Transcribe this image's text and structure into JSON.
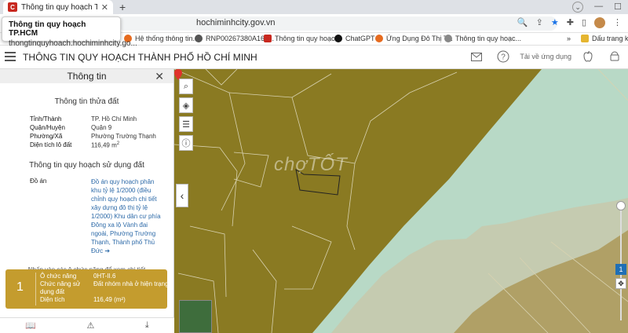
{
  "browser": {
    "tab_title": "Thông tin quy hoạch TP.HCM",
    "url_visible": "hochiminhcity.gov.vn",
    "tooltip": {
      "title": "Thông tin quy hoạch TP.HCM",
      "url": "thongtinquyhoach.hochiminhcity.go..."
    },
    "bookmarks": [
      {
        "label": "Hệ thống thông tin...",
        "icon": "orange"
      },
      {
        "label": "RNP00267380A16F...",
        "icon": "gear"
      },
      {
        "label": "Thông tin quy hoạc...",
        "icon": "favicon"
      },
      {
        "label": "ChatGPT",
        "icon": "chatgpt"
      },
      {
        "label": "Ứng Dụng Đô Thị T...",
        "icon": "orange"
      },
      {
        "label": "Thông tin quy hoạc...",
        "icon": "globe"
      },
      {
        "label": "Dấu trang khá",
        "icon": "folder"
      }
    ]
  },
  "app": {
    "title": "THÔNG TIN QUY HOẠCH THÀNH PHỐ HỒ CHÍ MINH",
    "download_app": "Tải về ứng dụng"
  },
  "panel": {
    "title": "Thông tin",
    "section_parcel": "Thông tin thửa đất",
    "parcel": [
      {
        "key": "Tỉnh/Thành",
        "value": "TP. Hồ Chí Minh"
      },
      {
        "key": "Quận/Huyện",
        "value": "Quận 9"
      },
      {
        "key": "Phường/Xã",
        "value": "Phường Trường Thạnh"
      },
      {
        "key": "Diện tích lô đất",
        "value": "116,49 m"
      }
    ],
    "area_sup": "2",
    "section_usage": "Thông tin quy hoạch sử dụng đất",
    "doan_key": "Đồ án",
    "doan_value": "Đồ án quy hoạch phân khu tỷ lệ 1/2000 (điều chỉnh quy hoạch chi tiết xây dựng đô thị tỷ lệ 1/2000) Khu dân cư phía Đông xa lộ Vành đai ngoài, Phường Trường Thạnh, Thành phố Thủ Đức ➔",
    "hint": "Nhấn vào các ô chức năng để xem chi tiết",
    "lot": {
      "number": "1",
      "rows": [
        {
          "key": "Ô chức năng",
          "value": "0HT-II.6"
        },
        {
          "key": "Chức năng sử dụng đất",
          "value": "Đất nhóm nhà ở hiện trạng"
        },
        {
          "key": "Diện tích",
          "value": "116,49 (m²)"
        }
      ]
    }
  },
  "map": {
    "watermark": "chợTỐT",
    "zoom_level": "1"
  },
  "colors": {
    "map_land": "#8a7a22",
    "map_river": "#a8dcc5",
    "lot_card": "#c49c2e",
    "link": "#2d6aa8"
  }
}
